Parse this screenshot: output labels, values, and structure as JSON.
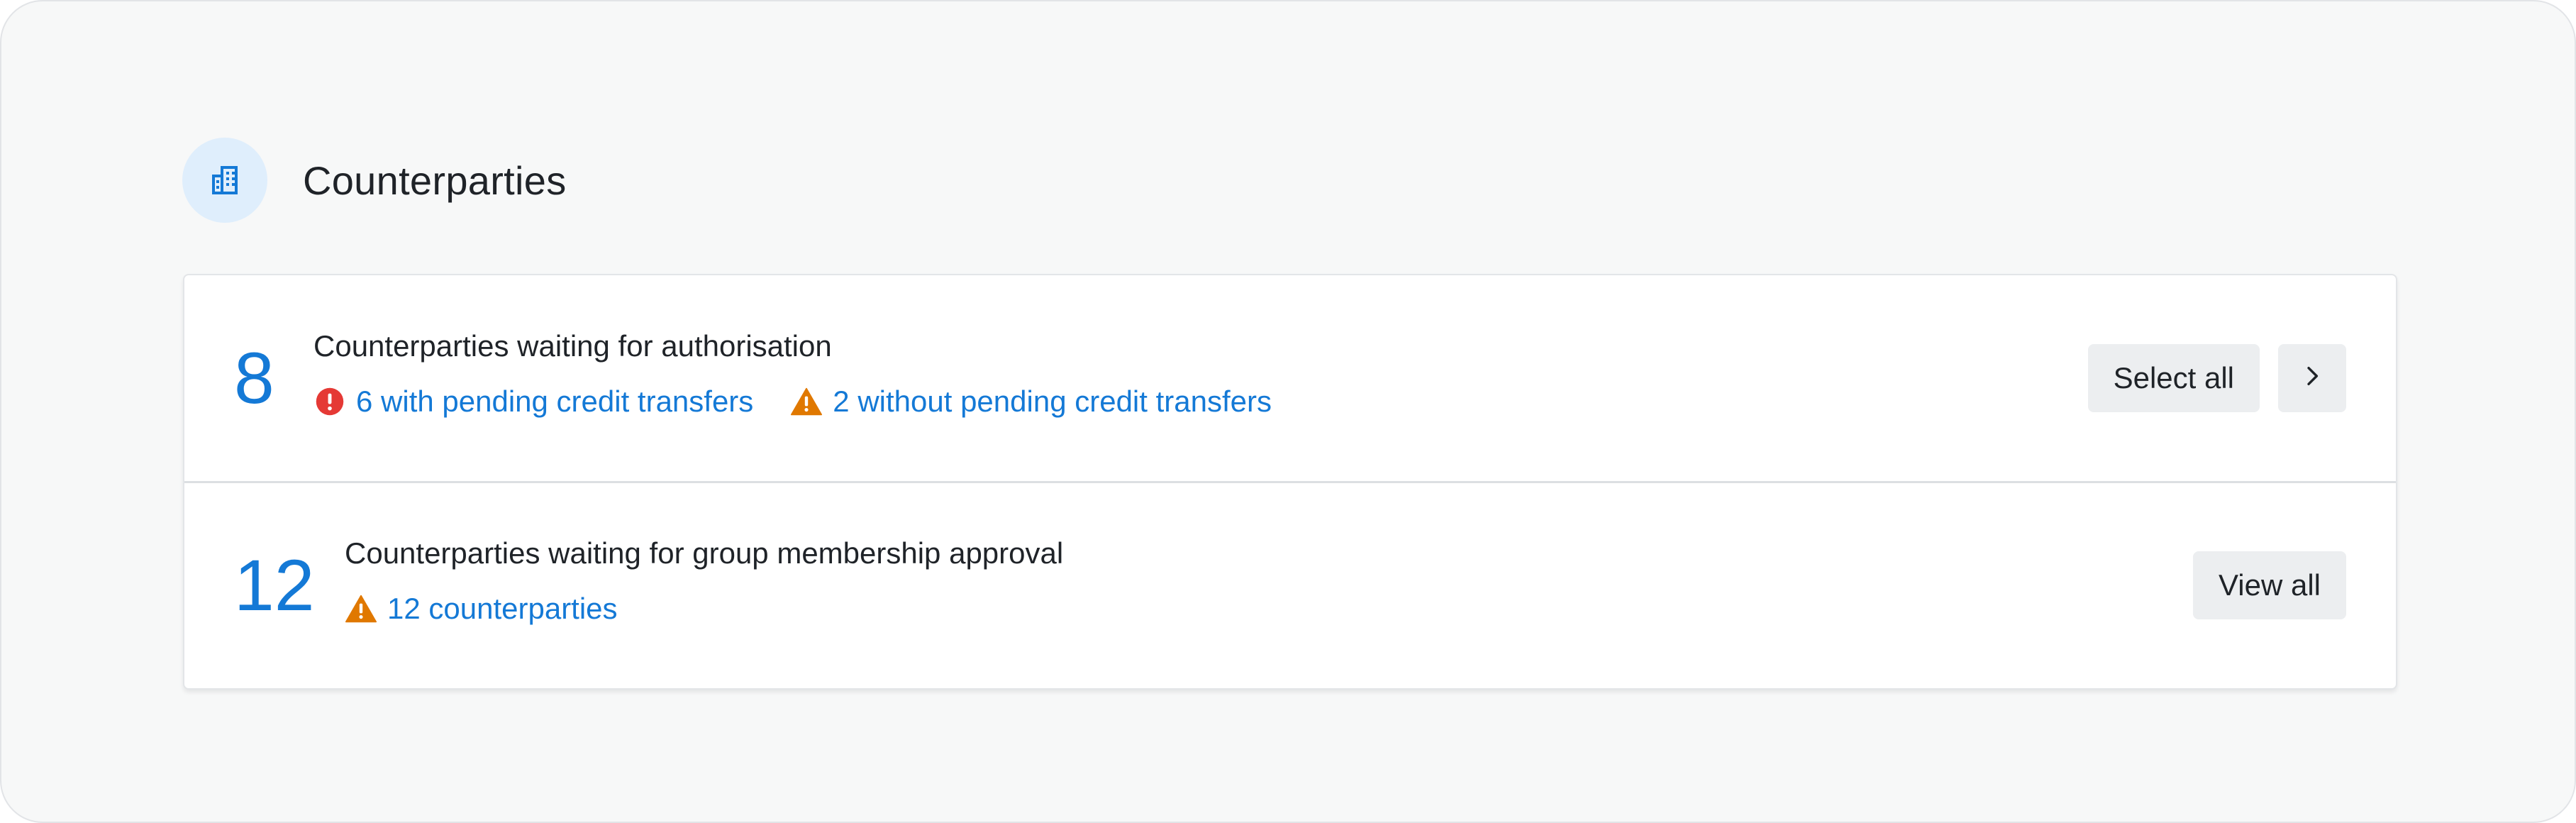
{
  "section": {
    "title": "Counterparties",
    "icon": "building-icon"
  },
  "colors": {
    "accent": "#1479d6",
    "error": "#e53935",
    "warning": "#e07800",
    "icon_bg": "#dfeefc"
  },
  "rows": [
    {
      "count": "8",
      "title": "Counterparties waiting for authorisation",
      "links": [
        {
          "icon": "error-circle-icon",
          "label": "6 with pending credit transfers"
        },
        {
          "icon": "warning-triangle-icon",
          "label": "2 without pending credit transfers"
        }
      ],
      "actions": {
        "primary_label": "Select all",
        "secondary_icon": "chevron-right-icon"
      }
    },
    {
      "count": "12",
      "title": "Counterparties waiting for group membership approval",
      "links": [
        {
          "icon": "warning-triangle-icon",
          "label": "12 counterparties"
        }
      ],
      "actions": {
        "primary_label": "View all"
      }
    }
  ]
}
